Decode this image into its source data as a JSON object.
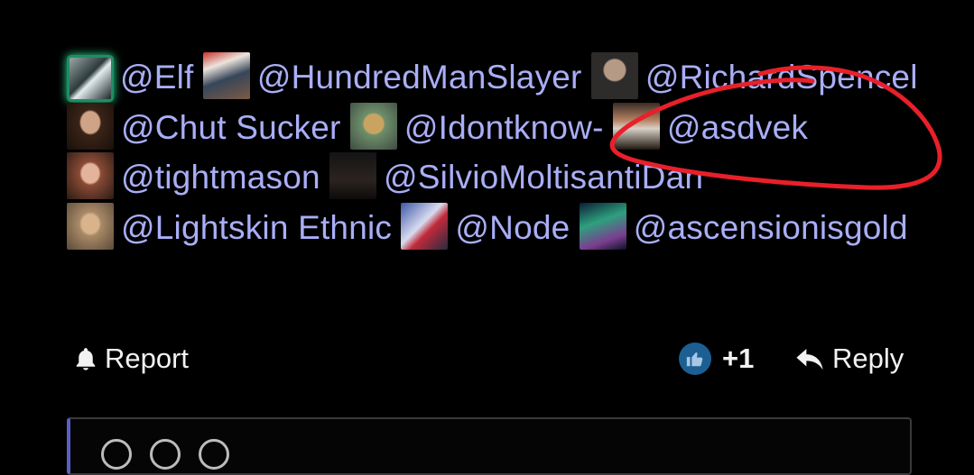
{
  "mentions": [
    {
      "avatar": "avatar-1",
      "name": "@Elf"
    },
    {
      "avatar": "avatar-2",
      "name": "@HundredManSlayer"
    },
    {
      "avatar": "avatar-3",
      "name": "@RichardSpencel"
    },
    {
      "avatar": "avatar-4",
      "name": "@Chut Sucker"
    },
    {
      "avatar": "avatar-5",
      "name": "@Idontknow-"
    },
    {
      "avatar": "avatar-6",
      "name": "@asdvek"
    },
    {
      "avatar": "avatar-7",
      "name": "@tightmason"
    },
    {
      "avatar": "avatar-8",
      "name": "@SilvioMoltisantiDan"
    },
    {
      "avatar": "avatar-9",
      "name": "@Lightskin Ethnic"
    },
    {
      "avatar": "avatar-10",
      "name": "@Node"
    },
    {
      "avatar": "avatar-11",
      "name": "@ascensionisgold"
    }
  ],
  "actions": {
    "report_label": "Report",
    "vote_count": "+1",
    "reply_label": "Reply"
  },
  "colors": {
    "background": "#000000",
    "mention_text": "#a9aef6",
    "annotation_scribble": "#e8202a",
    "avatar_highlight": "#2ddf98",
    "reply_box_accent": "#5a5fc7"
  },
  "icons": {
    "report": "bell-icon",
    "vote": "thumbs-up-icon",
    "reply": "reply-arrow-icon"
  }
}
